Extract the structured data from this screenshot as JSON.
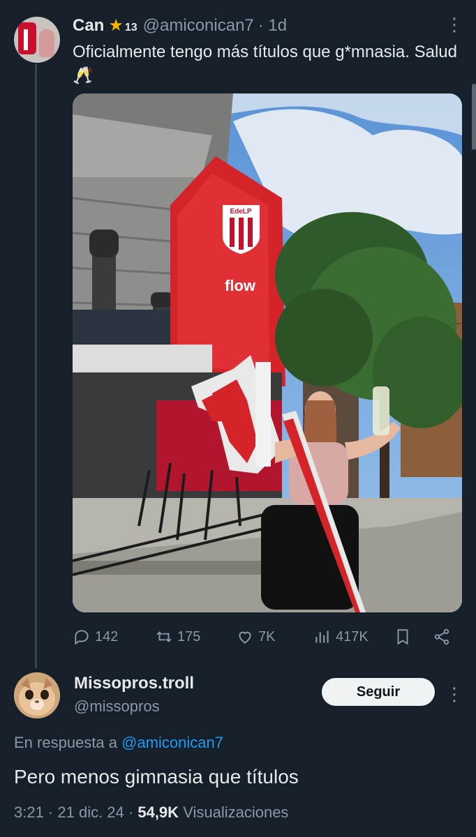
{
  "tweet": {
    "author_name": "Can",
    "badge_icon": "star-icon",
    "badge_count": "13",
    "handle": "@amiconican7",
    "time": "· 1d",
    "text": "Oficialmente tengo más títulos que g*mnasia. Salud 🥂",
    "photo_sign_text": "flow",
    "photo_crest_text": "EdeLP",
    "actions": {
      "replies": "142",
      "retweets": "175",
      "likes": "7K",
      "views": "417K"
    }
  },
  "reply": {
    "author_name": "Missopros.troll",
    "handle": "@missopros",
    "follow_label": "Seguir",
    "in_reply_to_prefix": "En respuesta a",
    "in_reply_to_handle": "@amiconican7",
    "text": "Pero menos gimnasia que títulos",
    "timestamp": "3:21 · 21 dic. 24 ·",
    "views_count": "54,9K",
    "views_label": "Visualizaciones"
  },
  "colors": {
    "background": "#15202b",
    "text_primary": "#e7e9ea",
    "text_secondary": "#8b98a5",
    "link": "#1d9bf0",
    "badge_star": "#f4b400"
  }
}
